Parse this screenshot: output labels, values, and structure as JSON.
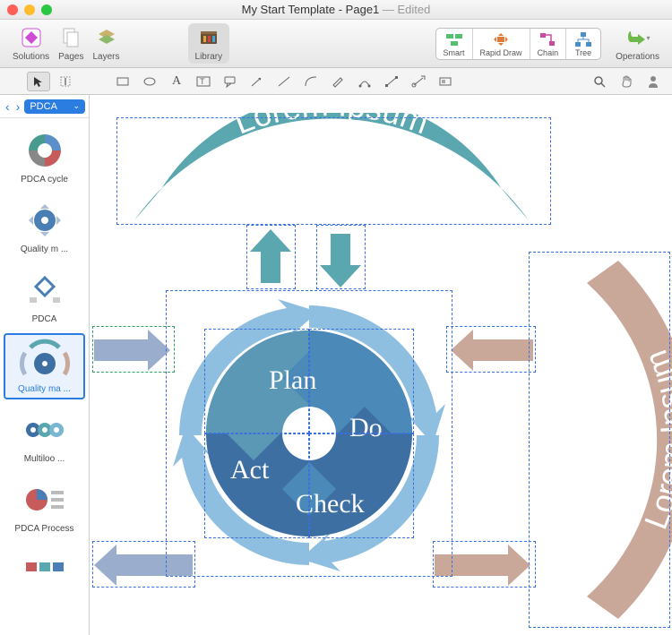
{
  "window": {
    "title_main": "My Start Template - Page1",
    "title_suffix": " — Edited"
  },
  "toolbar": {
    "solutions": "Solutions",
    "pages": "Pages",
    "layers": "Layers",
    "library": "Library",
    "smart": "Smart",
    "rapid": "Rapid Draw",
    "chain": "Chain",
    "tree": "Tree",
    "ops": "Operations"
  },
  "sidebar": {
    "dropdown": "PDCA",
    "items": [
      {
        "label": "PDCA cycle"
      },
      {
        "label": "Quality m ..."
      },
      {
        "label": "PDCA"
      },
      {
        "label": "Quality ma ..."
      },
      {
        "label": "Multiloo ..."
      },
      {
        "label": "PDCA Process"
      }
    ]
  },
  "diagram": {
    "top_arc": "Lorem Ipsum",
    "right_arc": "Lorem Ipsum",
    "wheel": {
      "plan": "Plan",
      "do": "Do",
      "check": "Check",
      "act": "Act"
    }
  }
}
